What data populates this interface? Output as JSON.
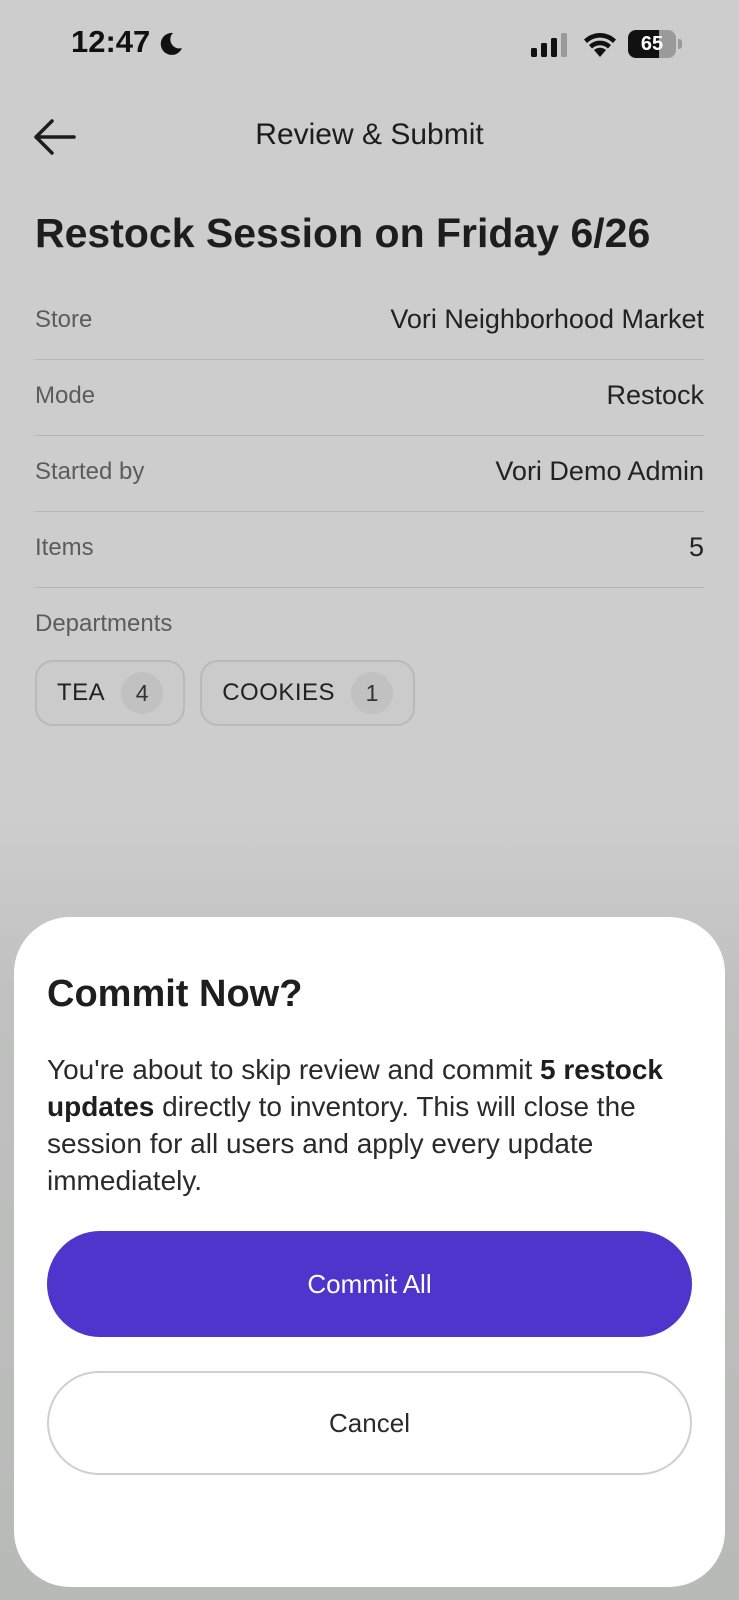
{
  "status_bar": {
    "time": "12:47",
    "battery": "65",
    "battery_level": 0.65
  },
  "header": {
    "title": "Review & Submit"
  },
  "session": {
    "title": "Restock Session on Friday 6/26",
    "details": [
      {
        "label": "Store",
        "value": "Vori Neighborhood Market"
      },
      {
        "label": "Mode",
        "value": "Restock"
      },
      {
        "label": "Started by",
        "value": "Vori Demo Admin"
      },
      {
        "label": "Items",
        "value": "5"
      }
    ],
    "departments_label": "Departments",
    "departments": [
      {
        "name": "TEA",
        "count": "4"
      },
      {
        "name": "COOKIES",
        "count": "1"
      }
    ]
  },
  "dialog": {
    "title": "Commit Now?",
    "body_pre": "You're about to skip review and commit ",
    "body_bold": "5 restock updates",
    "body_post": " directly to inventory. This will close the session for all users and apply every update immediately.",
    "commit_label": "Commit All",
    "cancel_label": "Cancel"
  },
  "colors": {
    "accent": "#5035cc",
    "overlay": "#cdcdcd",
    "sheet": "#ffffff"
  }
}
